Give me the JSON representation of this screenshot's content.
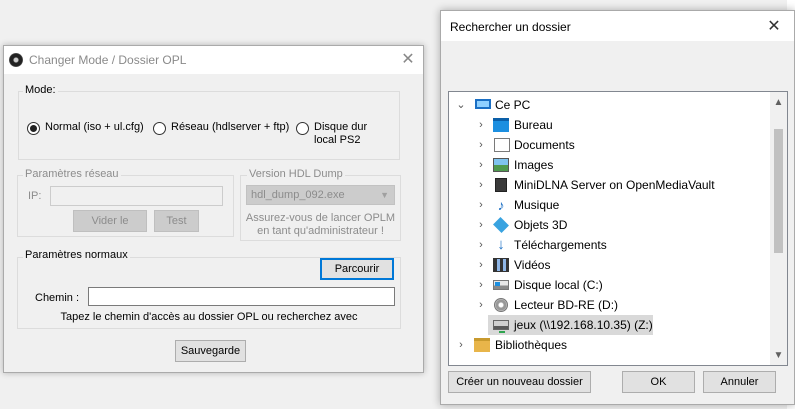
{
  "opl_window": {
    "title": "Changer Mode / Dossier OPL",
    "mode_group_label": "Mode:",
    "radio_normal": "Normal (iso + ul.cfg)",
    "radio_reseau": "Réseau (hdlserver + ftp)",
    "radio_disque_line1": "Disque dur",
    "radio_disque_line2": "local PS2",
    "selected_mode": "normal",
    "network_group_label": "Paramètres réseau",
    "ip_label": "IP:",
    "ip_value": "",
    "clear_button": "Vider le",
    "test_button": "Test",
    "hdl_group_label": "Version HDL Dump",
    "hdl_select_value": "hdl_dump_092.exe",
    "hdl_note_line1": "Assurez-vous de lancer OPLM",
    "hdl_note_line2": "en tant qu'administrateur !",
    "normal_group_label": "Paramètres normaux",
    "browse_button": "Parcourir",
    "path_label": "Chemin :",
    "path_value": "",
    "path_hint": "Tapez le chemin d'accès au dossier OPL ou recherchez avec",
    "save_button": "Sauvegarde"
  },
  "folder_dialog": {
    "title": "Rechercher un dossier",
    "tree": [
      {
        "label": "Ce PC",
        "icon": "computer-icon",
        "expanded": true
      },
      {
        "label": "Bureau",
        "icon": "desktop-folder-icon"
      },
      {
        "label": "Documents",
        "icon": "documents-icon"
      },
      {
        "label": "Images",
        "icon": "pictures-icon"
      },
      {
        "label": "MiniDLNA Server on OpenMediaVault",
        "icon": "media-server-icon"
      },
      {
        "label": "Musique",
        "icon": "music-icon"
      },
      {
        "label": "Objets 3D",
        "icon": "3d-objects-icon"
      },
      {
        "label": "Téléchargements",
        "icon": "downloads-icon"
      },
      {
        "label": "Vidéos",
        "icon": "videos-icon"
      },
      {
        "label": "Disque local (C:)",
        "icon": "local-disk-icon"
      },
      {
        "label": "Lecteur BD-RE (D:)",
        "icon": "bd-drive-icon"
      },
      {
        "label": "jeux (\\\\192.168.10.35) (Z:)",
        "icon": "network-drive-icon",
        "selected": true
      },
      {
        "label": "Bibliothèques",
        "icon": "libraries-icon"
      }
    ],
    "new_folder_button": "Créer un nouveau dossier",
    "ok_button": "OK",
    "cancel_button": "Annuler"
  }
}
